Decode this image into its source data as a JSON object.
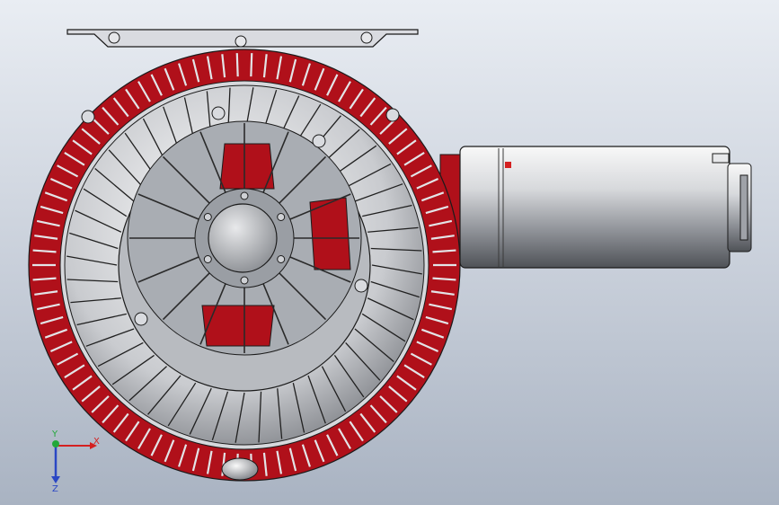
{
  "viewport": {
    "background_top": "#e9edf3",
    "background_bottom": "#a9b3c2"
  },
  "model": {
    "description_icon": "centrifugal-blower-assembly",
    "section_color": "#b0101a",
    "metal_light": "#f4f5f7",
    "metal_dark": "#6c6f75",
    "line_color": "#1b1b1b"
  },
  "triad": {
    "x_label": "X",
    "y_label": "Y",
    "z_label": "Z",
    "x_color": "#d42020",
    "y_color": "#23a83a",
    "z_color": "#2a47c4"
  }
}
